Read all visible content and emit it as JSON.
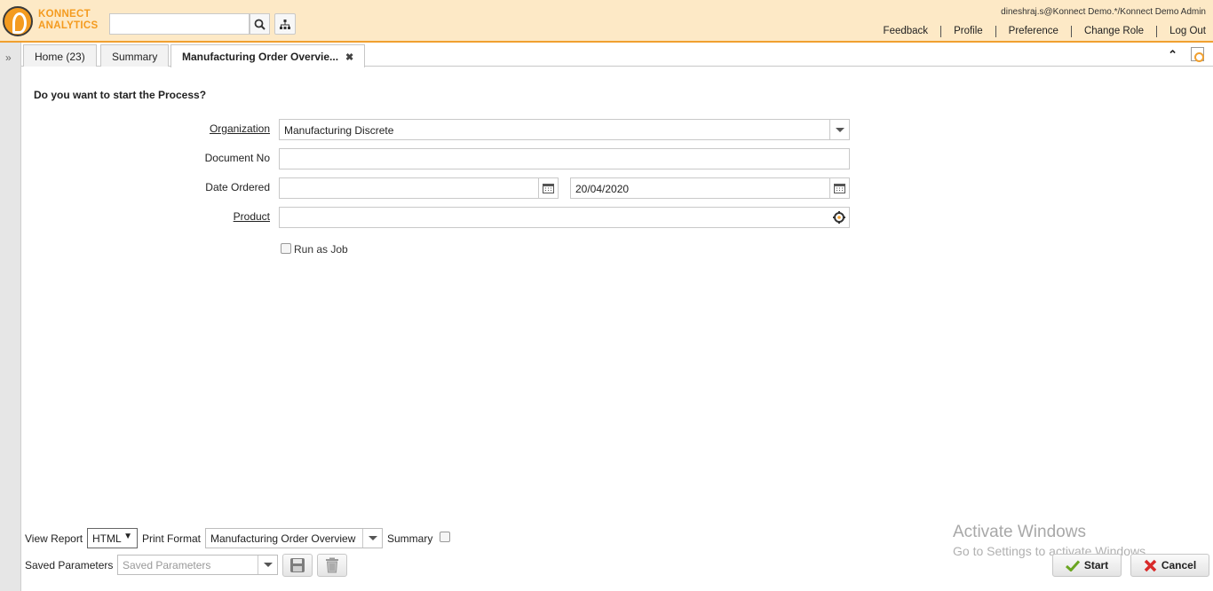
{
  "header": {
    "logo_line1": "KONNECT",
    "logo_line2": "ANALYTICS",
    "search_value": "",
    "user_info": "dineshraj.s@Konnect Demo.*/Konnect Demo Admin",
    "links": [
      "Feedback",
      "Profile",
      "Preference",
      "Change Role",
      "Log Out"
    ],
    "accent_color": "#f0a030"
  },
  "tabs": [
    {
      "label": "Home (23)"
    },
    {
      "label": "Summary"
    },
    {
      "label": "Manufacturing Order Overvie...",
      "active": true
    }
  ],
  "form": {
    "question": "Do you want to start the Process?",
    "organization_label": "Organization",
    "organization_value": "Manufacturing Discrete",
    "document_no_label": "Document No",
    "document_no_value": "",
    "date_ordered_label": "Date Ordered",
    "date_from_value": "",
    "date_to_value": "20/04/2020",
    "product_label": "Product",
    "product_value": "",
    "run_as_job_label": "Run as Job"
  },
  "bottom": {
    "view_report_label": "View Report",
    "view_report_value": "HTML",
    "print_format_label": "Print Format",
    "print_format_value": "Manufacturing Order Overview",
    "summary_label": "Summary",
    "saved_parameters_label": "Saved Parameters",
    "saved_parameters_placeholder": "Saved Parameters",
    "start_label": "Start",
    "cancel_label": "Cancel"
  },
  "watermark": {
    "line1": "Activate Windows",
    "line2": "Go to Settings to activate Windows."
  }
}
